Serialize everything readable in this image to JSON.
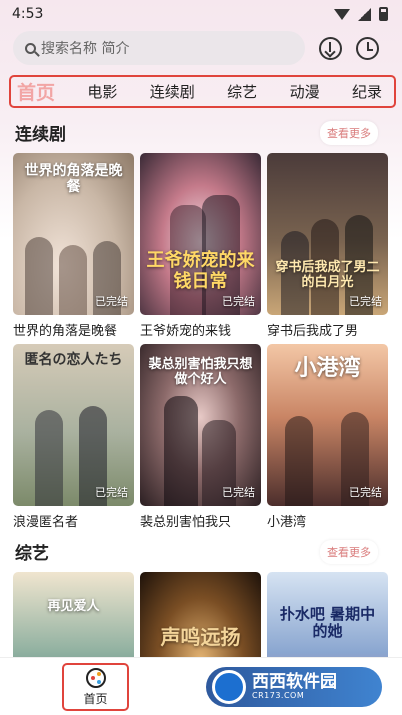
{
  "status_bar": {
    "time": "4:53"
  },
  "search": {
    "placeholder": "搜索名称 简介"
  },
  "tabs": [
    {
      "label": "首页",
      "active": true
    },
    {
      "label": "电影"
    },
    {
      "label": "连续剧"
    },
    {
      "label": "综艺"
    },
    {
      "label": "动漫"
    },
    {
      "label": "纪录"
    }
  ],
  "sections": [
    {
      "title": "连续剧",
      "more_label": "查看更多",
      "items": [
        {
          "name": "世界的角落是晚餐",
          "badge": "已完结",
          "poster_text": "世界的角落是晚餐"
        },
        {
          "name": "王爷娇宠的来钱",
          "badge": "已完结",
          "poster_text": "王爷娇宠的来钱日常"
        },
        {
          "name": "穿书后我成了男",
          "badge": "已完结",
          "poster_text": "穿书后我成了男二的白月光"
        },
        {
          "name": "浪漫匿名者",
          "badge": "已完结",
          "poster_text": "匿名の恋人たち"
        },
        {
          "name": "裴总别害怕我只",
          "badge": "已完结",
          "poster_text": "裴总别害怕我只想做个好人"
        },
        {
          "name": "小港湾",
          "badge": "已完结",
          "poster_text": "小港湾"
        }
      ]
    },
    {
      "title": "综艺",
      "more_label": "查看更多",
      "items": [
        {
          "poster_text": "再见爱人"
        },
        {
          "poster_text": "声鸣远扬"
        },
        {
          "poster_text": "扑水吧 暑期中的她"
        }
      ]
    }
  ],
  "bottom_nav": {
    "home_label": "首页"
  },
  "watermark": {
    "title": "西西软件园",
    "url": "CR173.COM"
  },
  "colors": {
    "accent_red": "#e0443c",
    "active_tab_pink": "#f2a5a5",
    "more_text": "#d97b7b"
  }
}
